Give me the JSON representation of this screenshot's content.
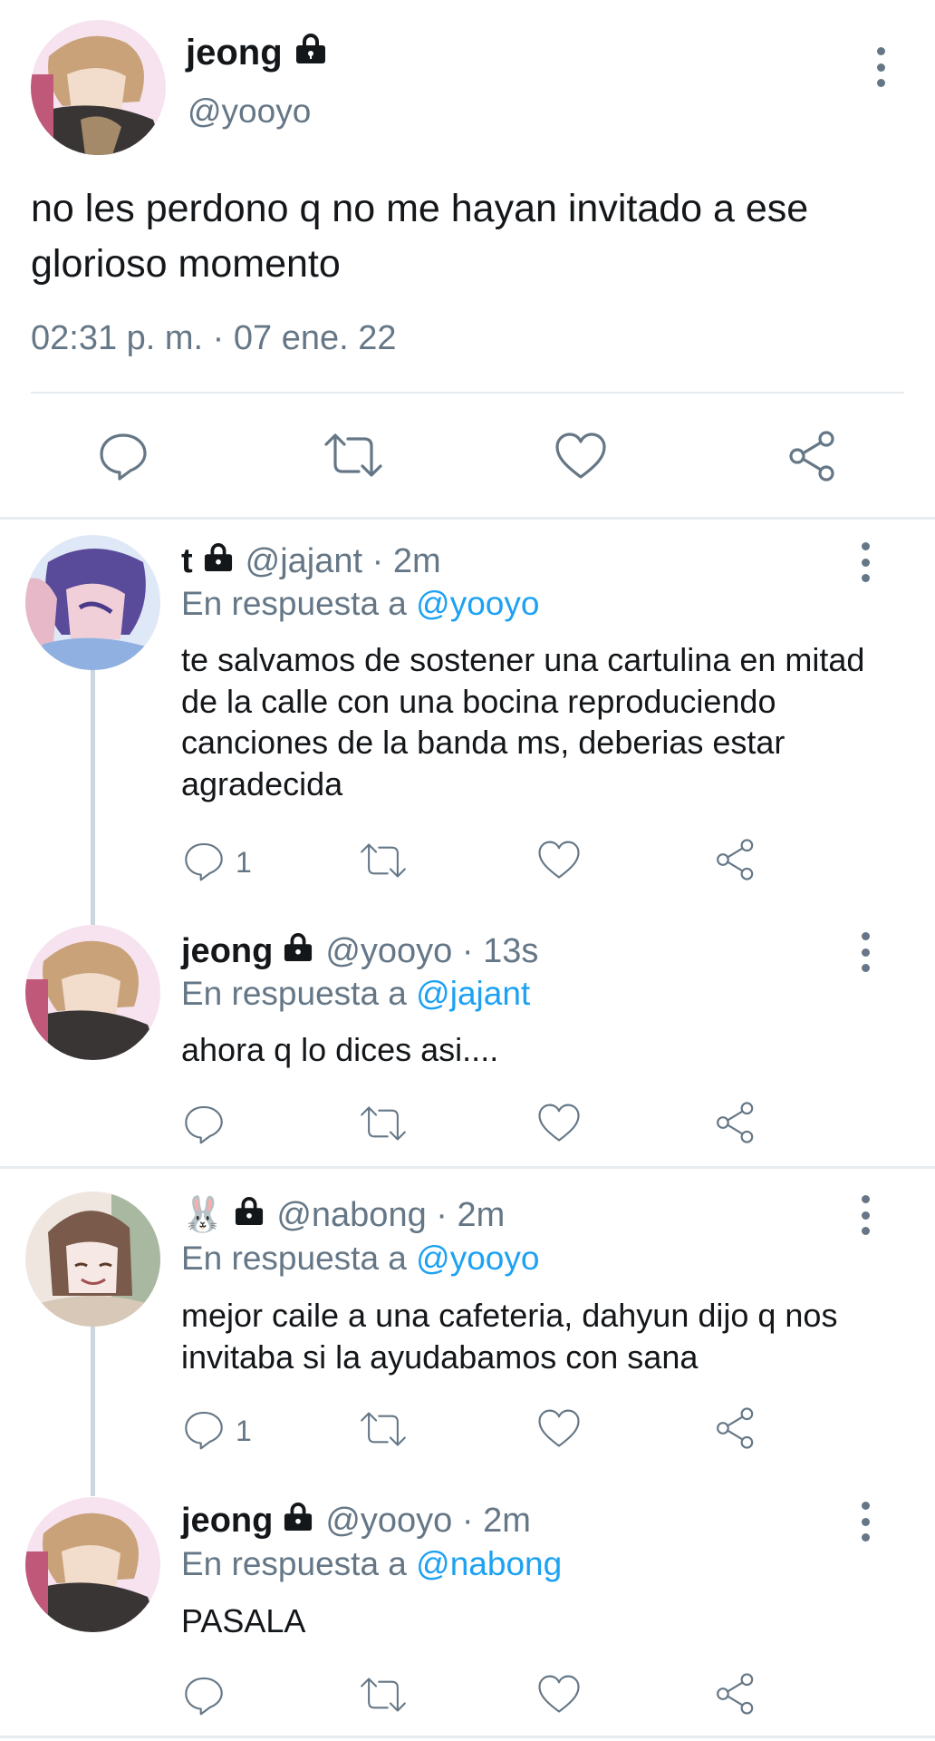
{
  "main_tweet": {
    "author_name": "jeong",
    "handle": "@yooyo",
    "text": "no les perdono q no me hayan invitado a ese glorioso momento",
    "timestamp": "02:31 p. m. · 07 ene. 22"
  },
  "replies": [
    {
      "name": "t",
      "handle_time": "@jajant · 2m",
      "in_reply_prefix": "En respuesta a",
      "in_reply_to": "@yooyo",
      "text": "te salvamos de sostener una cartulina en mitad de la calle con una bocina reproduciendo canciones de la banda ms, deberias estar agradecida",
      "reply_count": "1",
      "avatar_colors": [
        "#5a4a9a",
        "#e7b9c8",
        "#8fb0e0"
      ]
    },
    {
      "name": "jeong",
      "handle_time": "@yooyo · 13s",
      "in_reply_prefix": "En respuesta a",
      "in_reply_to": "@jajant",
      "text": "ahora q lo dices asi....",
      "reply_count": "",
      "avatar_colors": [
        "#c9a27a",
        "#3a3a3a",
        "#f4d6e6"
      ]
    },
    {
      "name": "🐰",
      "handle_time": "@nabong · 2m",
      "in_reply_prefix": "En respuesta a",
      "in_reply_to": "@yooyo",
      "text": "mejor caile a una cafeteria, dahyun dijo q nos invitaba si la ayudabamos con sana",
      "reply_count": "1",
      "avatar_colors": [
        "#7a5a4a",
        "#efe6e0",
        "#a9b8a0"
      ]
    },
    {
      "name": "jeong",
      "handle_time": "@yooyo · 2m",
      "in_reply_prefix": "En respuesta a",
      "in_reply_to": "@nabong",
      "text": "PASALA",
      "reply_count": "",
      "avatar_colors": [
        "#c9a27a",
        "#3a3a3a",
        "#f4d6e6"
      ]
    }
  ],
  "colors": {
    "accent": "#1da1f2",
    "secondary_text": "#657786",
    "divider": "#e6ecf0",
    "thread_line": "#ccd6dd"
  },
  "icons": [
    "lock-icon",
    "more-icon",
    "reply-icon",
    "retweet-icon",
    "like-icon",
    "share-icon"
  ]
}
